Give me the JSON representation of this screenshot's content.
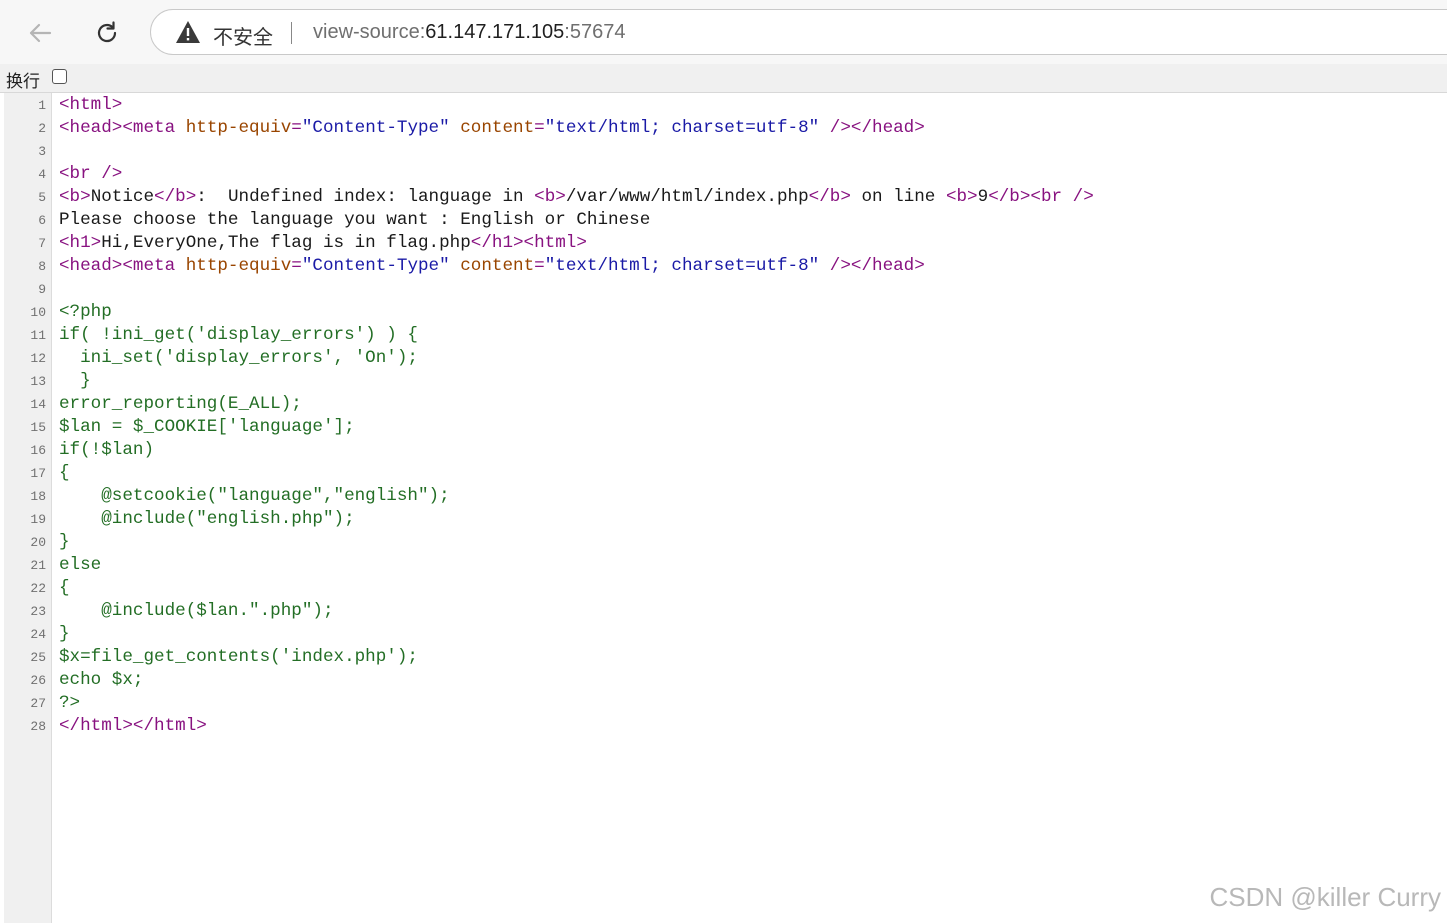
{
  "browser": {
    "security_label": "不安全",
    "url_scheme": "view-source:",
    "url_host": "61.147.171.105",
    "url_port": ":57674",
    "back_icon": "arrow-left-icon",
    "reload_icon": "reload-icon",
    "warning_icon": "warning-triangle-icon"
  },
  "wrap_toggle": {
    "label": "换行",
    "checked": false
  },
  "source_lines": [
    {
      "n": "1",
      "segs": [
        [
          "tag",
          "<html>"
        ]
      ]
    },
    {
      "n": "2",
      "segs": [
        [
          "tag",
          "<head><meta "
        ],
        [
          "attr",
          "http-equiv"
        ],
        [
          "tag",
          "="
        ],
        [
          "val",
          "\"Content-Type\""
        ],
        [
          "tag",
          " "
        ],
        [
          "attr",
          "content"
        ],
        [
          "tag",
          "="
        ],
        [
          "val",
          "\"text/html; charset=utf-8\""
        ],
        [
          "tag",
          " /></head>"
        ]
      ]
    },
    {
      "n": "3",
      "segs": []
    },
    {
      "n": "4",
      "segs": [
        [
          "tag",
          "<br />"
        ]
      ]
    },
    {
      "n": "5",
      "segs": [
        [
          "tag",
          "<b>"
        ],
        [
          "plain",
          "Notice"
        ],
        [
          "tag",
          "</b>"
        ],
        [
          "plain",
          ":  Undefined index: language in "
        ],
        [
          "tag",
          "<b>"
        ],
        [
          "plain",
          "/var/www/html/index.php"
        ],
        [
          "tag",
          "</b>"
        ],
        [
          "plain",
          " on line "
        ],
        [
          "tag",
          "<b>"
        ],
        [
          "plain",
          "9"
        ],
        [
          "tag",
          "</b><br />"
        ]
      ]
    },
    {
      "n": "6",
      "segs": [
        [
          "plain",
          "Please choose the language you want : English or Chinese"
        ]
      ]
    },
    {
      "n": "7",
      "segs": [
        [
          "tag",
          "<h1>"
        ],
        [
          "plain",
          "Hi,EveryOne,The flag is in flag.php"
        ],
        [
          "tag",
          "</h1><html>"
        ]
      ]
    },
    {
      "n": "8",
      "segs": [
        [
          "tag",
          "<head><meta "
        ],
        [
          "attr",
          "http-equiv"
        ],
        [
          "tag",
          "="
        ],
        [
          "val",
          "\"Content-Type\""
        ],
        [
          "tag",
          " "
        ],
        [
          "attr",
          "content"
        ],
        [
          "tag",
          "="
        ],
        [
          "val",
          "\"text/html; charset=utf-8\""
        ],
        [
          "tag",
          " /></head>"
        ]
      ]
    },
    {
      "n": "9",
      "segs": []
    },
    {
      "n": "10",
      "segs": [
        [
          "php",
          "<?php"
        ]
      ]
    },
    {
      "n": "11",
      "segs": [
        [
          "php",
          "if( !ini_get('display_errors') ) {"
        ]
      ]
    },
    {
      "n": "12",
      "segs": [
        [
          "php",
          "  ini_set('display_errors', 'On');"
        ]
      ]
    },
    {
      "n": "13",
      "segs": [
        [
          "php",
          "  }"
        ]
      ]
    },
    {
      "n": "14",
      "segs": [
        [
          "php",
          "error_reporting(E_ALL);"
        ]
      ]
    },
    {
      "n": "15",
      "segs": [
        [
          "php",
          "$lan = $_COOKIE['language'];"
        ]
      ]
    },
    {
      "n": "16",
      "segs": [
        [
          "php",
          "if(!$lan)"
        ]
      ]
    },
    {
      "n": "17",
      "segs": [
        [
          "php",
          "{"
        ]
      ]
    },
    {
      "n": "18",
      "segs": [
        [
          "php",
          "    @setcookie(\"language\",\"english\");"
        ]
      ]
    },
    {
      "n": "19",
      "segs": [
        [
          "php",
          "    @include(\"english.php\");"
        ]
      ]
    },
    {
      "n": "20",
      "segs": [
        [
          "php",
          "}"
        ]
      ]
    },
    {
      "n": "21",
      "segs": [
        [
          "php",
          "else"
        ]
      ]
    },
    {
      "n": "22",
      "segs": [
        [
          "php",
          "{"
        ]
      ]
    },
    {
      "n": "23",
      "segs": [
        [
          "php",
          "    @include($lan.\".php\");"
        ]
      ]
    },
    {
      "n": "24",
      "segs": [
        [
          "php",
          "}"
        ]
      ]
    },
    {
      "n": "25",
      "segs": [
        [
          "php",
          "$x=file_get_contents('index.php');"
        ]
      ]
    },
    {
      "n": "26",
      "segs": [
        [
          "php",
          "echo $x;"
        ]
      ]
    },
    {
      "n": "27",
      "segs": [
        [
          "php",
          "?>"
        ]
      ]
    },
    {
      "n": "28",
      "segs": [
        [
          "tag",
          "</html></html>"
        ]
      ]
    }
  ],
  "watermark": "CSDN @killer Curry"
}
